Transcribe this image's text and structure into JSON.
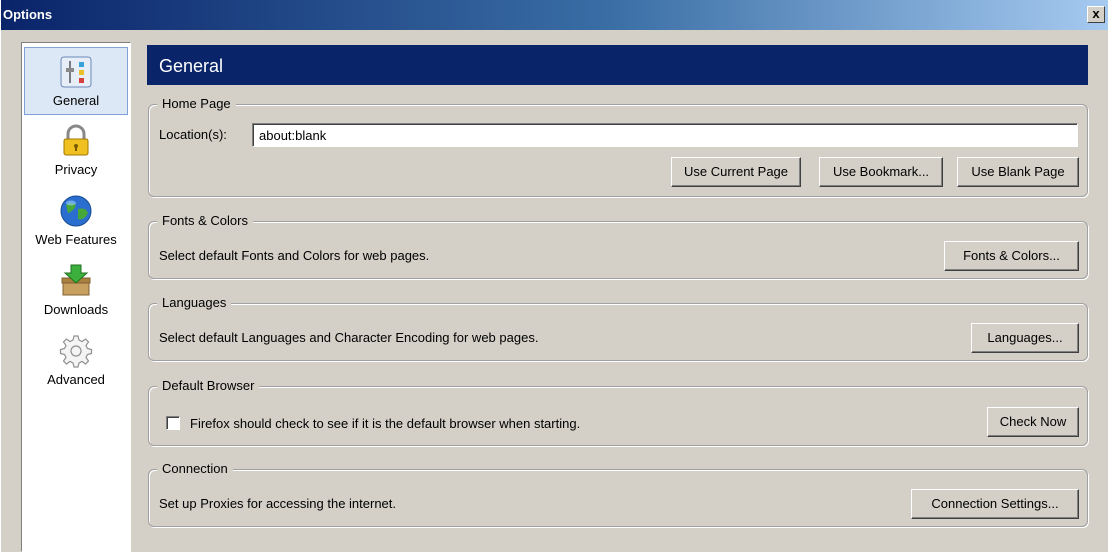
{
  "window": {
    "title": "Options",
    "close_label": "x"
  },
  "sidebar": {
    "items": [
      {
        "label": "General",
        "icon": "general-settings-icon",
        "selected": true
      },
      {
        "label": "Privacy",
        "icon": "padlock-icon",
        "selected": false
      },
      {
        "label": "Web Features",
        "icon": "globe-icon",
        "selected": false
      },
      {
        "label": "Downloads",
        "icon": "download-box-icon",
        "selected": false
      },
      {
        "label": "Advanced",
        "icon": "gear-icon",
        "selected": false
      }
    ]
  },
  "header": {
    "title": "General"
  },
  "home_page": {
    "group_title": "Home Page",
    "location_label": "Location(s):",
    "location_value": "about:blank",
    "use_current_label": "Use Current Page",
    "use_bookmark_label": "Use Bookmark...",
    "use_blank_label": "Use Blank Page"
  },
  "fonts_colors": {
    "group_title": "Fonts & Colors",
    "description": "Select default Fonts and Colors for web pages.",
    "button_label": "Fonts & Colors..."
  },
  "languages": {
    "group_title": "Languages",
    "description": "Select default Languages and Character Encoding for web pages.",
    "button_label": "Languages..."
  },
  "default_browser": {
    "group_title": "Default Browser",
    "checkbox_label": "Firefox should check to see if it is the default browser when starting.",
    "checked": false,
    "button_label": "Check Now"
  },
  "connection": {
    "group_title": "Connection",
    "description": "Set up Proxies for accessing the internet.",
    "button_label": "Connection Settings..."
  },
  "colors": {
    "header_bg": "#0a246a",
    "dialog_bg": "#d4d0c8",
    "selected_item_bg": "#dde8f6"
  }
}
